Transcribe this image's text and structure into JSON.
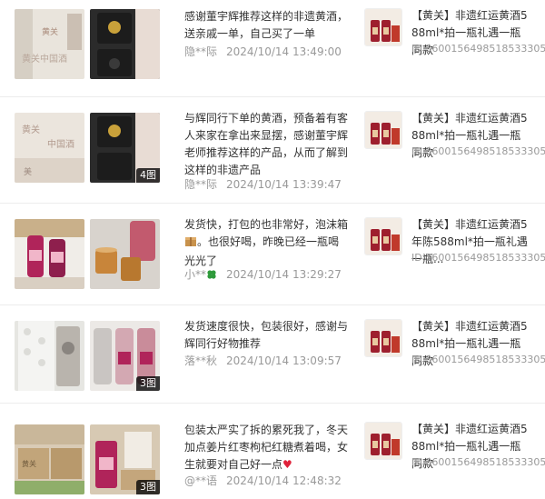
{
  "reviews": [
    {
      "text": "感谢董宇辉推荐这样的非遗黄酒，送亲戚一单，自己买了一单",
      "user": "隐**际",
      "date": "2024/10/14 13:49:00",
      "image_badge": "",
      "product": {
        "title": "【黄关】非遗红运黄酒588ml*拍一瓶礼遇一瓶同款",
        "id": "ID:3600156498518533305"
      }
    },
    {
      "text": "与辉同行下单的黄酒，预备着有客人来家在拿出来显摆，感谢董宇辉老师推荐这样的产品，从而了解到这样的非遗产品",
      "user": "隐**际",
      "date": "2024/10/14 13:39:47",
      "image_badge": "4图",
      "product": {
        "title": "【黄关】非遗红运黄酒588ml*拍一瓶礼遇一瓶同款",
        "id": "ID:3600156498518533305"
      }
    },
    {
      "text_before": "发货快，打包的也非常好，泡沫箱",
      "text_after": "。也很好喝，昨晚已经一瓶喝光光了",
      "user": "小**",
      "date": "2024/10/14 13:29:27",
      "image_badge": "",
      "product": {
        "title": "【黄关】非遗红运黄酒5年陈588ml*拍一瓶礼遇一瓶...",
        "id": "ID:3600156498518533305"
      }
    },
    {
      "text": "发货速度很快，包装很好，感谢与辉同行好物推荐",
      "user": "落**秋",
      "date": "2024/10/14 13:09:57",
      "image_badge": "3图",
      "product": {
        "title": "【黄关】非遗红运黄酒588ml*拍一瓶礼遇一瓶同款",
        "id": "ID:3600156498518533305"
      }
    },
    {
      "text": "包装太严实了拆的累死我了，冬天加点姜片红枣枸杞红糖煮着喝，女生就要对自己好一点",
      "user": "@**语",
      "date": "2024/10/14 12:48:32",
      "image_badge": "3图",
      "product": {
        "title": "【黄关】非遗红运黄酒588ml*拍一瓶礼遇一瓶同款",
        "id": "ID:3600156498518533305"
      }
    }
  ],
  "icons": {
    "box_emoji": "box-emoji-icon",
    "clover": "four-leaf-clover-icon",
    "heart": "red-heart-icon"
  },
  "colors": {
    "wine": "#9e1f2e",
    "label": "#e8c9a0",
    "muted_text": "#999999",
    "heart": "#e0223a",
    "clover": "#2e9a3a"
  }
}
